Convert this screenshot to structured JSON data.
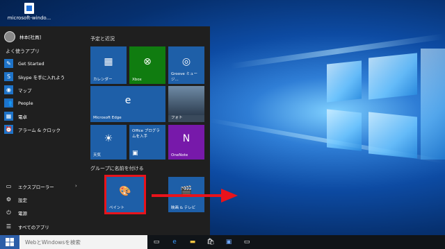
{
  "desktop": {
    "icon_label": "microsoft-windo..."
  },
  "start_menu": {
    "user": {
      "name": "林本[社員]"
    },
    "most_used_header": "よく使うアプリ",
    "most_used": [
      {
        "label": "Get Started",
        "icon": "lightbulb-icon"
      },
      {
        "label": "Skype を手に入れよう",
        "icon": "skype-icon"
      },
      {
        "label": "マップ",
        "icon": "map-icon"
      },
      {
        "label": "People",
        "icon": "people-icon"
      },
      {
        "label": "電卓",
        "icon": "calculator-icon"
      },
      {
        "label": "アラーム & クロック",
        "icon": "alarm-clock-icon"
      }
    ],
    "bottom": [
      {
        "label": "エクスプローラー",
        "icon": "folder-icon"
      },
      {
        "label": "設定",
        "icon": "gear-icon"
      },
      {
        "label": "電源",
        "icon": "power-icon"
      },
      {
        "label": "すべてのアプリ",
        "icon": "all-apps-icon"
      }
    ],
    "groups": {
      "group1_header": "予定と近況",
      "group2_header": "グループに名前を付ける"
    },
    "tiles": [
      {
        "label": "カレンダー",
        "icon": "calendar-icon",
        "color": "#1e5fa8"
      },
      {
        "label": "Xbox",
        "icon": "xbox-icon",
        "color": "#107c10"
      },
      {
        "label": "Groove ミュージ...",
        "icon": "groove-icon",
        "color": "#1e5fa8"
      },
      {
        "label": "Microsoft Edge",
        "icon": "edge-icon",
        "color": "#1e5fa8"
      },
      {
        "label": "フォト",
        "icon": "photos-icon",
        "color": "#3a4a5c"
      },
      {
        "label": "天気",
        "icon": "weather-icon",
        "color": "#1e5fa8"
      },
      {
        "label": "Office プログラムを入手",
        "icon": "office-icon",
        "color": "#1e5fa8"
      },
      {
        "label": "OneNote",
        "icon": "onenote-icon",
        "color": "#7719aa"
      },
      {
        "label": "ペイント",
        "icon": "paint-icon",
        "color": "#1e5fa8"
      },
      {
        "label": "映画 & テレビ",
        "icon": "movies-tv-icon",
        "color": "#1e5fa8"
      }
    ]
  },
  "taskbar": {
    "search_placeholder": "WebとWindowsを検索"
  },
  "annotation": {
    "highlight_color": "#e8131b"
  }
}
